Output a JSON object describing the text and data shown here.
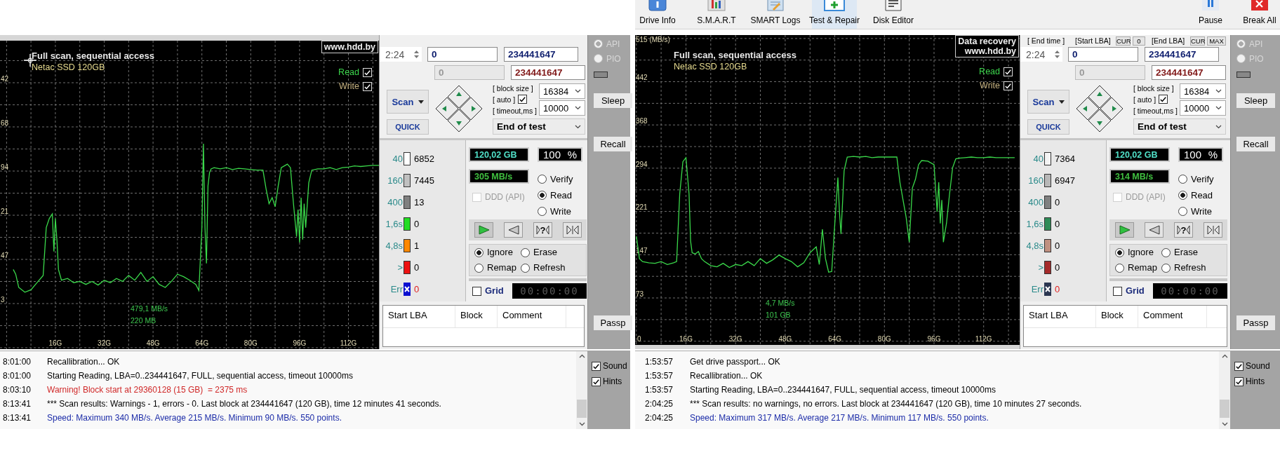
{
  "panels": [
    {
      "graph": {
        "title": "Full scan, sequential access",
        "drive": "Netac SSD 120GB",
        "logo": [
          "www.hdd.by"
        ],
        "mouse_pointer": true,
        "y_axis_labels": [
          "42",
          "68",
          "94",
          "21",
          "47",
          "3"
        ],
        "x_axis_labels": [
          "16G",
          "32G",
          "48G",
          "64G",
          "80G",
          "96G",
          "112G"
        ],
        "legend": [
          {
            "label": "Read",
            "checked": true,
            "color": "#3cd64c"
          },
          {
            "label": "Write",
            "checked": true,
            "color": "#c8b482"
          }
        ],
        "readout": [
          "479,1 MB/s",
          "220 MB"
        ]
      },
      "controls": {
        "end_time": "2:24",
        "start_lba": "0",
        "end_lba": "234441647",
        "current_lba": "0",
        "current_end_lba": "234441647",
        "scan": "Scan",
        "quick": "QUICK",
        "block_size_label": "[ block size ]",
        "auto_label": "[ auto ]",
        "auto": true,
        "timeout_label": "[ timeout,ms ]",
        "block_size": "16384",
        "timeout": "10000",
        "on_end": "End of test",
        "capacity": "120,02 GB",
        "percent": "100",
        "percent_sign": "%",
        "speed": "305 MB/s",
        "ddd": {
          "label": "DDD (API)",
          "checked": false,
          "disabled": true
        },
        "modes": [
          {
            "label": "Verify",
            "selected": false
          },
          {
            "label": "Read",
            "selected": true
          },
          {
            "label": "Write",
            "selected": false
          }
        ],
        "player": [
          {
            "kind": "play"
          },
          {
            "kind": "reverse"
          },
          {
            "kind": "seek",
            "label": "?"
          },
          {
            "kind": "end"
          }
        ],
        "actions": [
          {
            "label": "Ignore",
            "selected": true
          },
          {
            "label": "Erase",
            "selected": false
          },
          {
            "label": "Remap",
            "selected": false
          },
          {
            "label": "Refresh",
            "selected": false
          }
        ],
        "grid": {
          "label": "Grid",
          "checked": false
        },
        "timer": "00:00:00"
      },
      "counters": [
        {
          "kind": "bar",
          "label": "40",
          "count": "6852",
          "color": "#ffffff"
        },
        {
          "kind": "bar",
          "label": "160",
          "count": "7445",
          "color": "#c0c0c0"
        },
        {
          "kind": "bar",
          "label": "400",
          "count": "13",
          "color": "#808080"
        },
        {
          "kind": "bar",
          "label": "1,6s",
          "count": "0",
          "color": "#22dd22"
        },
        {
          "kind": "bar",
          "label": "4,8s",
          "count": "1",
          "color": "#ff8800"
        },
        {
          "kind": "bar",
          "label": ">",
          "count": "0",
          "color": "#ee1111"
        },
        {
          "kind": "error",
          "label": "Err",
          "count": "0",
          "color": "#0a10d0"
        }
      ],
      "table": {
        "columns": [
          "Start LBA",
          "Block",
          "Comment"
        ]
      },
      "side": {
        "interfaces": [
          {
            "label": "API",
            "selected": true
          },
          {
            "label": "PIO",
            "selected": false
          }
        ],
        "buttons": [
          "Sleep",
          "Recall",
          "Passp"
        ]
      },
      "log": [
        {
          "time": "8:01:00",
          "text": "Recallibration... OK",
          "kind": "info"
        },
        {
          "time": "8:01:00",
          "text": "Starting Reading, LBA=0..234441647, FULL, sequential access, timeout 10000ms",
          "kind": "info"
        },
        {
          "time": "8:03:10",
          "text": "Warning! Block start at 29360128 (15 GB)  = 2375 ms",
          "kind": "warning"
        },
        {
          "time": "8:13:41",
          "text": "*** Scan results: Warnings - 1, errors - 0. Last block at 234441647 (120 GB), time 12 minutes 41 seconds.",
          "kind": "info"
        },
        {
          "time": "8:13:41",
          "text": "Speed: Maximum 340 MB/s. Average 215 MB/s. Minimum 90 MB/s. 550 points.",
          "kind": "speed"
        }
      ],
      "options": [
        {
          "label": "Sound",
          "checked": true
        },
        {
          "label": "Hints",
          "checked": true
        }
      ]
    },
    {
      "toolbar": {
        "items": [
          {
            "kind": "info",
            "label": "Drive Info",
            "selected": false
          },
          {
            "kind": "smart",
            "label": "S.M.A.R.T",
            "selected": false
          },
          {
            "kind": "logs",
            "label": "SMART Logs",
            "selected": false
          },
          {
            "kind": "test",
            "label": "Test & Repair",
            "selected": true
          },
          {
            "kind": "editor",
            "label": "Disk Editor",
            "selected": false
          }
        ],
        "right_items": [
          {
            "kind": "pause",
            "label": "Pause",
            "selected": false
          },
          {
            "kind": "stop",
            "label": "Break All",
            "selected": false
          }
        ]
      },
      "graph": {
        "title": "Full scan, sequential access",
        "drive": "Netac SSD 120GB",
        "logo": [
          "Data recovery",
          "www.hdd.by"
        ],
        "mouse_pointer": false,
        "legend": [
          {
            "label": "Read",
            "checked": true,
            "color": "#3cd64c"
          },
          {
            "label": "Write",
            "checked": true,
            "color": "#c8b482"
          }
        ],
        "readout": [
          "4,7 MB/s",
          "101 GB"
        ],
        "chart_data": {
          "type": "line",
          "grid": true,
          "xlim": [
            -0.4,
            123.6
          ],
          "ylim": [
            -7,
            520.8
          ],
          "xticks": [
            {
              "value": 0,
              "label": "0"
            },
            {
              "value": 16,
              "label": "16G"
            },
            {
              "value": 32,
              "label": "32G"
            },
            {
              "value": 48,
              "label": "48G"
            },
            {
              "value": 64,
              "label": "64G"
            },
            {
              "value": 80,
              "label": "80G"
            },
            {
              "value": 96,
              "label": "96G"
            },
            {
              "value": 112,
              "label": "112G"
            }
          ],
          "yticks": [
            {
              "value": 73,
              "label": "73"
            },
            {
              "value": 147,
              "label": "147"
            },
            {
              "value": 221,
              "label": "221"
            },
            {
              "value": 294,
              "label": "294"
            },
            {
              "value": 368,
              "label": "368"
            },
            {
              "value": 442,
              "label": "442"
            },
            {
              "value": 515,
              "label": "515 (MB/s)"
            }
          ],
          "x": [
            0,
            1,
            2,
            4,
            6,
            8,
            10,
            12,
            13,
            14,
            15,
            16,
            17,
            17.5,
            18,
            19,
            20,
            21,
            22,
            24,
            26,
            28,
            30,
            32,
            34,
            36,
            38,
            40,
            42,
            44,
            46,
            48,
            50,
            52,
            54,
            56,
            58,
            59,
            60,
            61,
            62,
            63,
            64,
            65,
            65.5,
            66,
            67,
            68,
            70,
            72,
            74,
            76,
            78,
            80,
            82,
            84,
            85,
            86,
            87,
            88,
            89,
            90,
            91,
            92,
            94,
            96,
            97,
            97.5,
            98,
            98.5,
            99,
            100,
            101,
            102,
            103,
            104,
            106,
            108,
            110,
            112,
            114,
            116,
            118,
            120,
            122
          ],
          "series": [
            {
              "color": "#3ad84a",
              "values": [
                178,
                140,
                135,
                133,
                132,
                135,
                130,
                133,
                135,
                250,
                305,
                312,
                250,
                170,
                150,
                148,
                152,
                140,
                135,
                128,
                126,
                132,
                125,
                130,
                128,
                135,
                128,
                140,
                132,
                138,
                146,
                140,
                135,
                126,
                133,
                150,
                160,
                130,
                190,
                140,
                117,
                118,
                200,
                278,
                220,
                182,
                290,
                313,
                314,
                313,
                314,
                312,
                313,
                313,
                313,
                313,
                270,
                240,
                210,
                168,
                260,
                275,
                300,
                307,
                306,
                300,
                220,
                270,
                200,
                240,
                168,
                200,
                250,
                295,
                310,
                311,
                312,
                313,
                312,
                312,
                313,
                312,
                312,
                312,
                312
              ]
            }
          ]
        }
      },
      "controls": {
        "header": {
          "end_time": "[ End time ]",
          "start_lba": "[Start LBA]",
          "start_cur": "CUR",
          "start_zero": "0",
          "end_lba": "[End LBA]",
          "end_cur": "CUR",
          "end_max": "MAX"
        },
        "end_time": "2:24",
        "start_lba": "0",
        "end_lba": "234441647",
        "current_lba": "0",
        "current_end_lba": "234441647",
        "scan": "Scan",
        "quick": "QUICK",
        "block_size_label": "[ block size ]",
        "auto_label": "[ auto ]",
        "auto": true,
        "timeout_label": "[ timeout,ms ]",
        "block_size": "16384",
        "timeout": "10000",
        "on_end": "End of test",
        "capacity": "120,02 GB",
        "percent": "100",
        "percent_sign": "%",
        "speed": "314 MB/s",
        "ddd": {
          "label": "DDD (API)",
          "checked": false,
          "disabled": true
        },
        "modes": [
          {
            "label": "Verify",
            "selected": false
          },
          {
            "label": "Read",
            "selected": true
          },
          {
            "label": "Write",
            "selected": false
          }
        ],
        "player": [
          {
            "kind": "play"
          },
          {
            "kind": "reverse"
          },
          {
            "kind": "seek",
            "label": "?"
          },
          {
            "kind": "end"
          }
        ],
        "actions": [
          {
            "label": "Ignore",
            "selected": true
          },
          {
            "label": "Erase",
            "selected": false
          },
          {
            "label": "Remap",
            "selected": false
          },
          {
            "label": "Refresh",
            "selected": false
          }
        ],
        "grid": {
          "label": "Grid",
          "checked": false
        },
        "timer": "00:00:00"
      },
      "counters": [
        {
          "kind": "bar",
          "label": "40",
          "count": "7364",
          "color": "#f4f4f4"
        },
        {
          "kind": "bar",
          "label": "160",
          "count": "6947",
          "color": "#b8b8b8"
        },
        {
          "kind": "bar",
          "label": "400",
          "count": "0",
          "color": "#808080"
        },
        {
          "kind": "bar",
          "label": "1,6s",
          "count": "0",
          "color": "#2e8b57"
        },
        {
          "kind": "bar",
          "label": "4,8s",
          "count": "0",
          "color": "#c09080"
        },
        {
          "kind": "bar",
          "label": ">",
          "count": "0",
          "color": "#a52a2a"
        },
        {
          "kind": "error",
          "label": "Err",
          "count": "0",
          "color": "#2a3550"
        }
      ],
      "table": {
        "columns": [
          "Start LBA",
          "Block",
          "Comment"
        ]
      },
      "side": {
        "interfaces": [
          {
            "label": "API",
            "selected": true
          },
          {
            "label": "PIO",
            "selected": false
          }
        ],
        "buttons": [
          "Sleep",
          "Recall",
          "Passp"
        ]
      },
      "log": [
        {
          "time": "1:53:57",
          "text": "Get drive passport... OK",
          "kind": "info"
        },
        {
          "time": "1:53:57",
          "text": "Recallibration... OK",
          "kind": "info"
        },
        {
          "time": "1:53:57",
          "text": "Starting Reading, LBA=0..234441647, FULL, sequential access, timeout 10000ms",
          "kind": "info"
        },
        {
          "time": "2:04:25",
          "text": "*** Scan results: no warnings, no errors. Last block at 234441647 (120 GB), time 10 minutes 27 seconds.",
          "kind": "info"
        },
        {
          "time": "2:04:25",
          "text": "Speed: Maximum 317 MB/s. Average 217 MB/s. Minimum 117 MB/s. 550 points.",
          "kind": "speed"
        }
      ],
      "options": [
        {
          "label": "Sound",
          "checked": true
        },
        {
          "label": "Hints",
          "checked": true
        }
      ]
    }
  ]
}
